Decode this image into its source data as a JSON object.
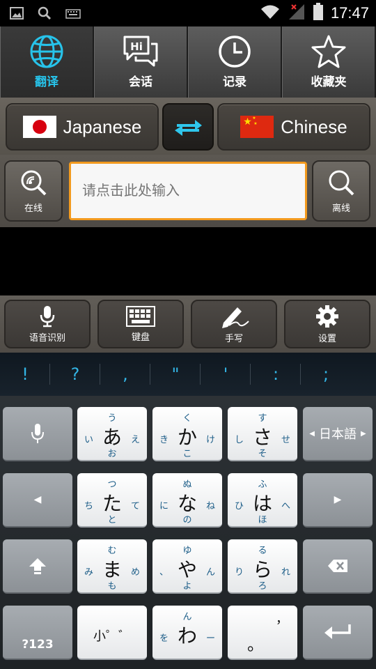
{
  "status_bar": {
    "time": "17:47",
    "icons": [
      "image-icon",
      "search-icon",
      "keyboard-icon",
      "wifi-icon",
      "signal-icon",
      "battery-icon"
    ]
  },
  "tabs": [
    {
      "label": "翻译",
      "icon": "globe-icon",
      "active": true
    },
    {
      "label": "会话",
      "icon": "chat-bubble-icon",
      "icon_text": "Hi",
      "active": false
    },
    {
      "label": "记录",
      "icon": "clock-icon",
      "active": false
    },
    {
      "label": "收藏夹",
      "icon": "star-icon",
      "active": false
    }
  ],
  "language": {
    "source": "Japanese",
    "target": "Chinese"
  },
  "search": {
    "online_label": "在线",
    "offline_label": "离线",
    "placeholder": "请点击此处输入"
  },
  "tools": [
    {
      "label": "语音识别",
      "icon": "microphone-icon"
    },
    {
      "label": "键盘",
      "icon": "keyboard-icon"
    },
    {
      "label": "手写",
      "icon": "pen-icon"
    },
    {
      "label": "设置",
      "icon": "gear-icon"
    }
  ],
  "symbols": [
    "!",
    "?",
    ",",
    "\"",
    "'",
    ":",
    ";"
  ],
  "keyboard": {
    "keys": [
      {
        "main": "あ",
        "top": "う",
        "left": "い",
        "right": "え",
        "bottom": "お"
      },
      {
        "main": "か",
        "top": "く",
        "left": "き",
        "right": "け",
        "bottom": "こ"
      },
      {
        "main": "さ",
        "top": "す",
        "left": "し",
        "right": "せ",
        "bottom": "そ"
      },
      {
        "main": "た",
        "top": "つ",
        "left": "ち",
        "right": "て",
        "bottom": "と"
      },
      {
        "main": "な",
        "top": "ぬ",
        "left": "に",
        "right": "ね",
        "bottom": "の"
      },
      {
        "main": "は",
        "top": "ふ",
        "left": "ひ",
        "right": "へ",
        "bottom": "ほ"
      },
      {
        "main": "ま",
        "top": "む",
        "left": "み",
        "right": "め",
        "bottom": "も"
      },
      {
        "main": "や",
        "top": "ゆ",
        "left": "、",
        "right": "ん",
        "bottom": "よ"
      },
      {
        "main": "ら",
        "top": "る",
        "left": "り",
        "right": "れ",
        "bottom": "ろ"
      },
      {
        "main": "小゜゛",
        "top": "",
        "left": "",
        "right": "",
        "bottom": ""
      },
      {
        "main": "わ",
        "top": "ん",
        "left": "を",
        "right": "ー",
        "bottom": ""
      },
      {
        "main": "。",
        "top": "，",
        "left": "",
        "right": "",
        "bottom": ""
      }
    ],
    "lang_label": "日本語",
    "numeric_label": "?123"
  }
}
